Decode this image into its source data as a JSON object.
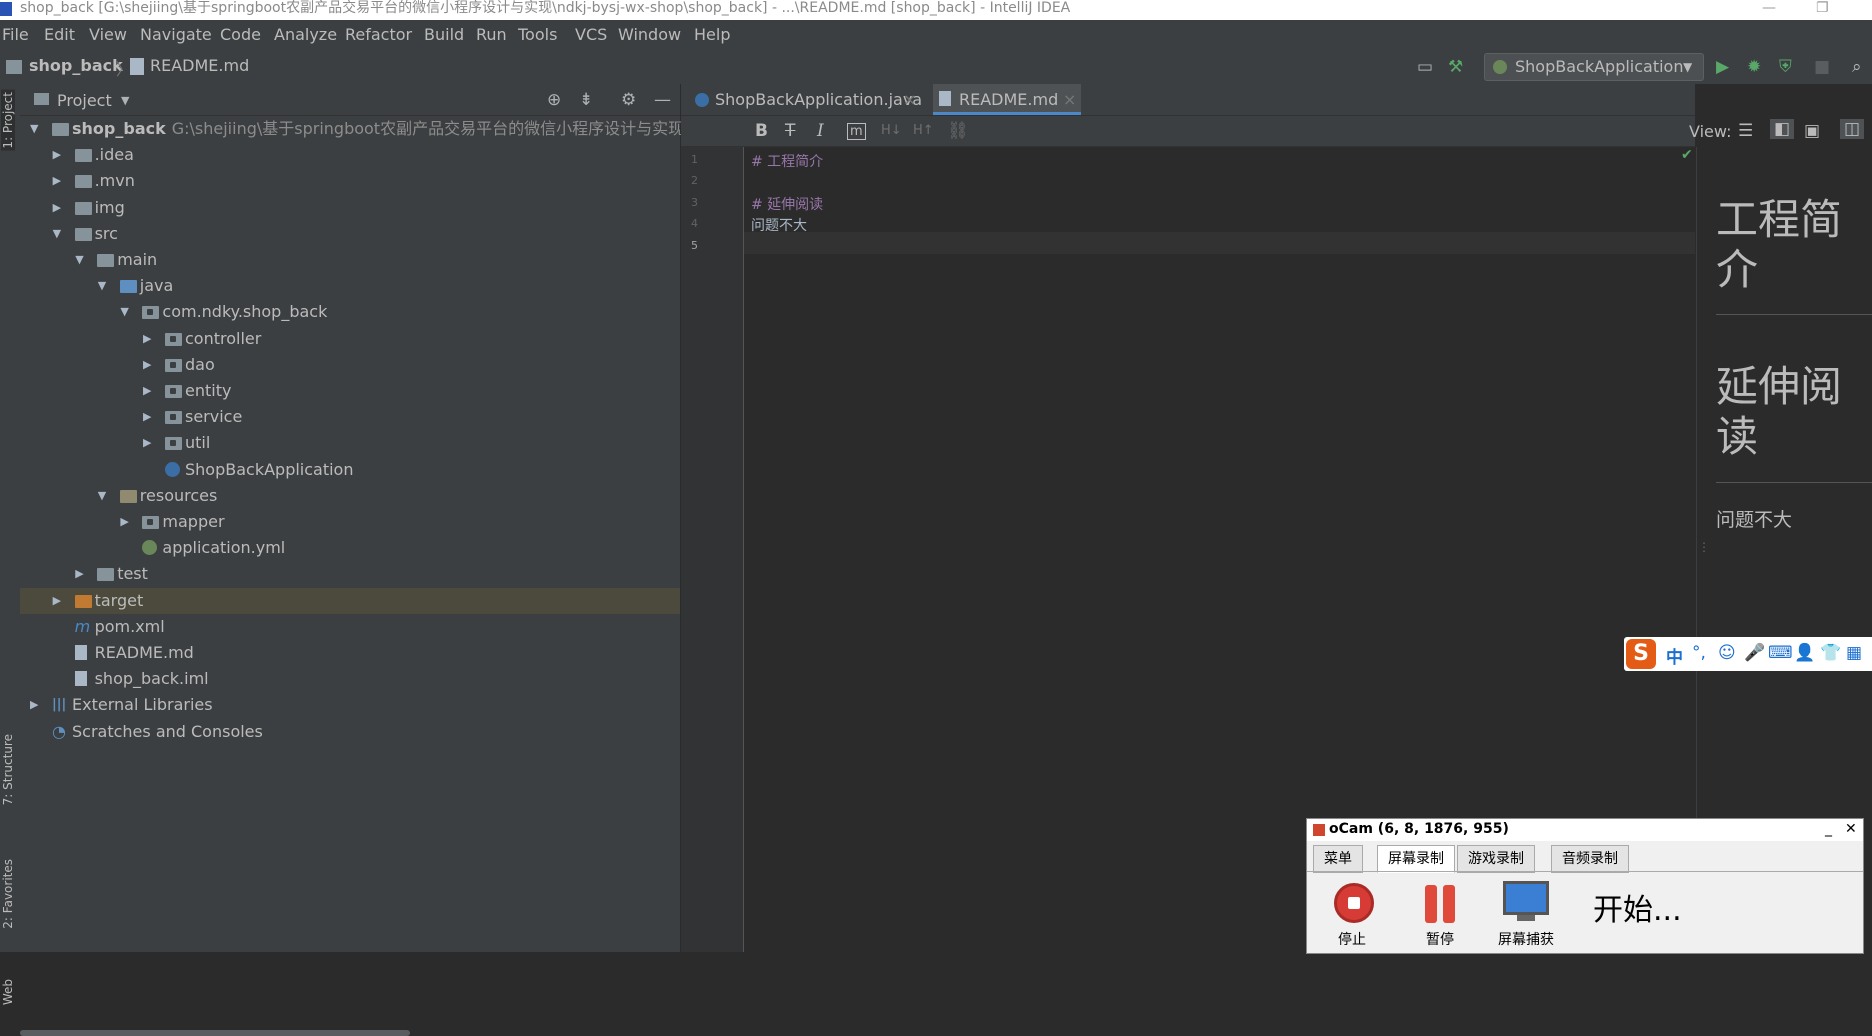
{
  "window": {
    "title": "shop_back [G:\\shejiing\\基于springboot农副产品交易平台的微信小程序设计与实现\\ndkj-bysj-wx-shop\\shop_back] - ...\\README.md [shop_back] - IntelliJ IDEA",
    "minimize": "—",
    "restore": "❐"
  },
  "menu": [
    "File",
    "Edit",
    "View",
    "Navigate",
    "Code",
    "Analyze",
    "Refactor",
    "Build",
    "Run",
    "Tools",
    "VCS",
    "Window",
    "Help"
  ],
  "breadcrumb": {
    "project": "shop_back",
    "file": "README.md"
  },
  "toolbar": {
    "run_config": "ShopBackApplication"
  },
  "side_tabs": {
    "project": "1: Project",
    "structure": "7: Structure",
    "favorites": "2: Favorites",
    "web": "Web"
  },
  "project_panel": {
    "title": "Project",
    "tree": [
      {
        "label": "shop_back",
        "path": "G:\\shejiing\\基于springboot农副产品交易平台的微信小程序设计与实现\\ndkj-",
        "depth": 0,
        "arrow": "down",
        "icon": "module"
      },
      {
        "label": ".idea",
        "depth": 1,
        "arrow": "right",
        "icon": "folder"
      },
      {
        "label": ".mvn",
        "depth": 1,
        "arrow": "right",
        "icon": "folder"
      },
      {
        "label": "img",
        "depth": 1,
        "arrow": "right",
        "icon": "folder"
      },
      {
        "label": "src",
        "depth": 1,
        "arrow": "down",
        "icon": "folder"
      },
      {
        "label": "main",
        "depth": 2,
        "arrow": "down",
        "icon": "folder"
      },
      {
        "label": "java",
        "depth": 3,
        "arrow": "down",
        "icon": "folder-blue"
      },
      {
        "label": "com.ndky.shop_back",
        "depth": 4,
        "arrow": "down",
        "icon": "package"
      },
      {
        "label": "controller",
        "depth": 5,
        "arrow": "right",
        "icon": "package"
      },
      {
        "label": "dao",
        "depth": 5,
        "arrow": "right",
        "icon": "package"
      },
      {
        "label": "entity",
        "depth": 5,
        "arrow": "right",
        "icon": "package"
      },
      {
        "label": "service",
        "depth": 5,
        "arrow": "right",
        "icon": "package"
      },
      {
        "label": "util",
        "depth": 5,
        "arrow": "right",
        "icon": "package"
      },
      {
        "label": "ShopBackApplication",
        "depth": 5,
        "arrow": "",
        "icon": "spring-class"
      },
      {
        "label": "resources",
        "depth": 3,
        "arrow": "down",
        "icon": "folder-res"
      },
      {
        "label": "mapper",
        "depth": 4,
        "arrow": "right",
        "icon": "package"
      },
      {
        "label": "application.yml",
        "depth": 4,
        "arrow": "",
        "icon": "yml"
      },
      {
        "label": "test",
        "depth": 2,
        "arrow": "right",
        "icon": "folder"
      },
      {
        "label": "target",
        "depth": 1,
        "arrow": "right",
        "icon": "folder-orange",
        "selected": true
      },
      {
        "label": "pom.xml",
        "depth": 1,
        "arrow": "",
        "icon": "maven"
      },
      {
        "label": "README.md",
        "depth": 1,
        "arrow": "",
        "icon": "md"
      },
      {
        "label": "shop_back.iml",
        "depth": 1,
        "arrow": "",
        "icon": "file"
      },
      {
        "label": "External Libraries",
        "depth": 0,
        "arrow": "right",
        "icon": "libs"
      },
      {
        "label": "Scratches and Consoles",
        "depth": 0,
        "arrow": "",
        "icon": "scratch"
      }
    ]
  },
  "editor": {
    "tabs": [
      {
        "label": "ShopBackApplication.java",
        "active": false
      },
      {
        "label": "README.md",
        "active": true
      }
    ],
    "view_label": "View:",
    "format_buttons": [
      "B",
      "T",
      "I",
      "m",
      "H↓",
      "H↑",
      "link"
    ],
    "lines": [
      {
        "num": "1",
        "text": "# 工程简介",
        "kind": "h"
      },
      {
        "num": "2",
        "text": "",
        "kind": "t"
      },
      {
        "num": "3",
        "text": "# 延伸阅读",
        "kind": "h"
      },
      {
        "num": "4",
        "text": "问题不大",
        "kind": "t"
      },
      {
        "num": "5",
        "text": "",
        "kind": "t"
      }
    ],
    "preview": {
      "h1a": "工程简介",
      "h1b": "延伸阅读",
      "p": "问题不大"
    }
  },
  "ime_bar": {
    "logo": "S",
    "lang": "中",
    "items": [
      "°,",
      "☺",
      "🎤",
      "⌨",
      "👤",
      "👕",
      "▦"
    ]
  },
  "ocam": {
    "title": "oCam (6, 8, 1876, 955)",
    "tabs": [
      "菜单",
      "屏幕录制",
      "游戏录制",
      "音频录制"
    ],
    "active_tab": "屏幕录制",
    "buttons": [
      "停止",
      "暂停",
      "屏幕捕获"
    ],
    "status": "开始..."
  }
}
